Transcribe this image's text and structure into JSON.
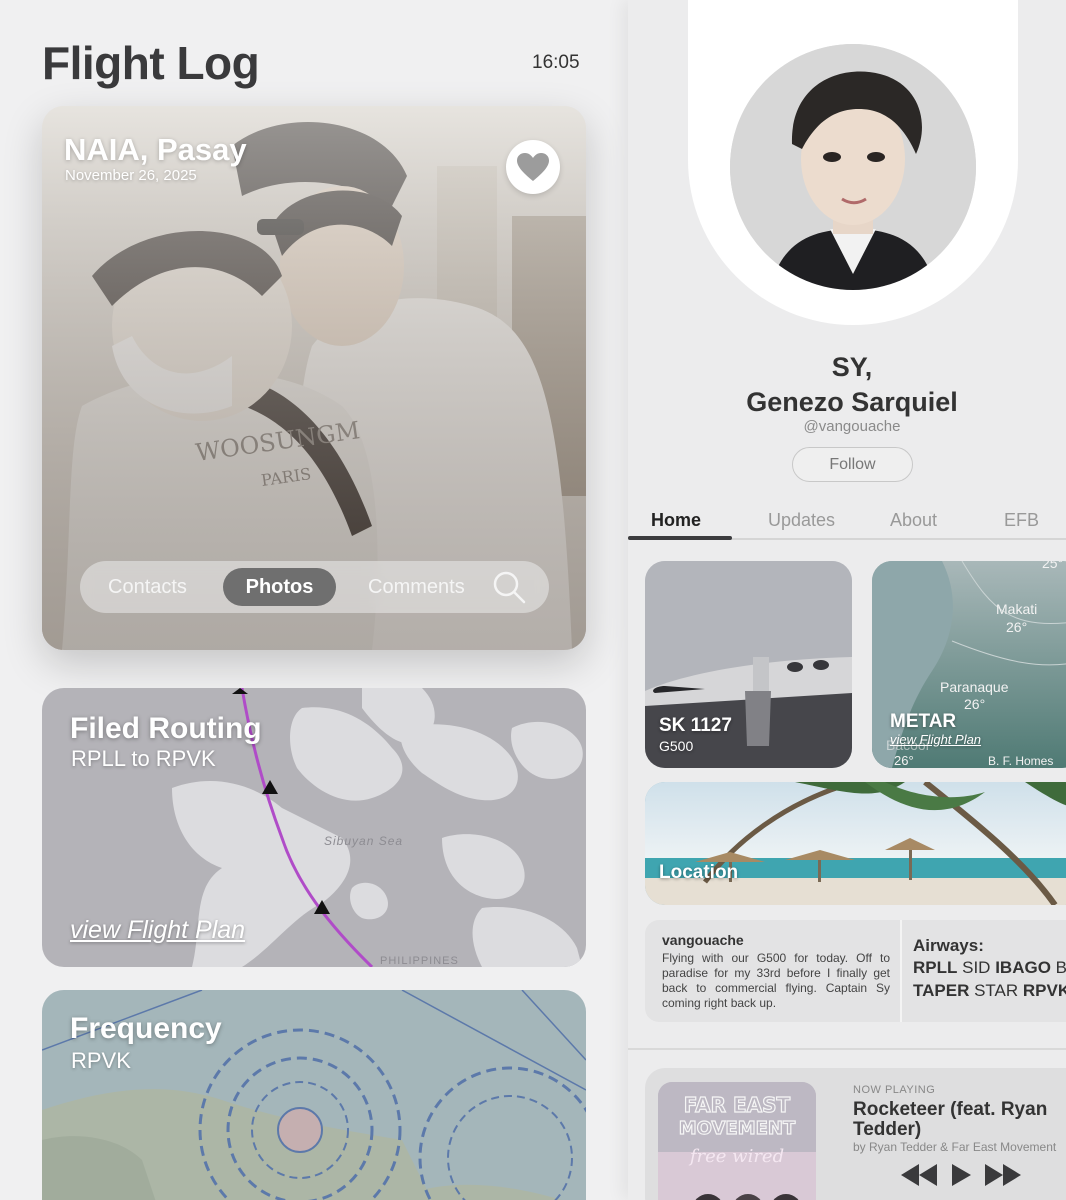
{
  "app": {
    "title": "Flight Log",
    "time": "16:05"
  },
  "photo_card": {
    "location": "NAIA, Pasay",
    "date": "November 26, 2025",
    "tabs": {
      "contacts": "Contacts",
      "photos": "Photos",
      "comments": "Comments"
    },
    "heart_icon": "heart-icon",
    "search_icon": "search-icon"
  },
  "routing_card": {
    "title": "Filed Routing",
    "subtitle": "RPLL to RPVK",
    "link": "view Flight Plan",
    "map_labels": {
      "sea": "Sibuyan Sea",
      "country": "PHILIPPINES"
    }
  },
  "frequency_card": {
    "title": "Frequency",
    "subtitle": "RPVK"
  },
  "profile": {
    "name_line1": "SY,",
    "name_line2": "Genezo Sarquiel",
    "handle": "@vangouache",
    "follow_label": "Follow"
  },
  "tabs": [
    {
      "label": "Home",
      "active": true
    },
    {
      "label": "Updates",
      "active": false
    },
    {
      "label": "About",
      "active": false
    },
    {
      "label": "EFB",
      "active": false
    }
  ],
  "tiles": {
    "aircraft": {
      "title": "SK 1127",
      "subtitle": "G500"
    },
    "metar": {
      "title": "METAR",
      "link": "view Flight Plan",
      "temps": {
        "top": "25°",
        "makati_name": "Makati",
        "makati_temp": "26°",
        "paranaque_name": "Paranaque",
        "paranaque_temp": "26°",
        "bacoor_name": "Bacoor",
        "bacoor_temp": "26°",
        "bf_homes": "B. F. Homes"
      }
    },
    "location": {
      "title": "Location"
    }
  },
  "post": {
    "user": "vangouache",
    "body": "Flying with our G500 for today. Off to paradise for my 33rd before I finally get back to commercial flying. Captain Sy coming right back up."
  },
  "airways": {
    "title": "Airways:",
    "row1": [
      "RPLL",
      "SID",
      "IBAGO",
      "B"
    ],
    "row2": [
      "TAPER",
      "STAR",
      "RPVK"
    ]
  },
  "now_playing": {
    "label": "NOW PLAYING",
    "song": "Rocketeer (feat. Ryan Tedder)",
    "artist": "by Ryan Tedder & Far East Movement",
    "album_text": {
      "line1": "FAR EAST",
      "line2": "MOVEMENT",
      "line3": "free wired"
    },
    "controls": [
      "rewind-icon",
      "play-icon",
      "fast-forward-icon"
    ]
  },
  "colors": {
    "route_line": "#b04cc8",
    "tab_active": "#3c3c3e",
    "segment_active": "#6f6f6f",
    "map_land": "#dcdcdf",
    "map_water": "#b4b3b8"
  }
}
